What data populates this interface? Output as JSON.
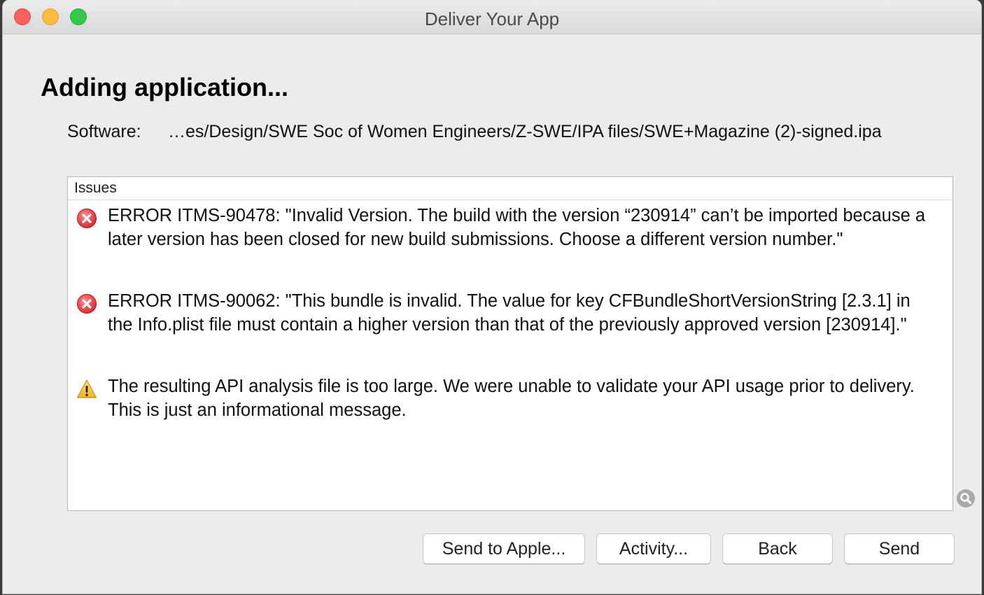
{
  "window": {
    "title": "Deliver Your App"
  },
  "heading": "Adding application...",
  "software": {
    "label": "Software:",
    "path": "…es/Design/SWE Soc of Women Engineers/Z-SWE/IPA files/SWE+Magazine (2)-signed.ipa"
  },
  "issues": {
    "header": "Issues",
    "items": [
      {
        "type": "error",
        "icon": "error-icon",
        "text": "ERROR ITMS-90478: \"Invalid Version. The build with the version “230914” can’t be imported because a later version has been closed for new build submissions. Choose a different version number.\""
      },
      {
        "type": "error",
        "icon": "error-icon",
        "text": "ERROR ITMS-90062: \"This bundle is invalid. The value for key CFBundleShortVersionString [2.3.1] in the Info.plist file must contain a higher version than that of the previously approved version [230914].\""
      },
      {
        "type": "warning",
        "icon": "warning-icon",
        "text": "The resulting API analysis file is too large.  We were unable to validate your API usage prior to delivery.  This is just an informational message."
      }
    ]
  },
  "buttons": {
    "send_to_apple": "Send to Apple...",
    "activity": "Activity...",
    "back": "Back",
    "send": "Send"
  },
  "colors": {
    "close": "#fc605c",
    "minimize": "#fdbc40",
    "zoom": "#34c84a",
    "error": "#e0333a",
    "warning": "#f5c63b"
  }
}
